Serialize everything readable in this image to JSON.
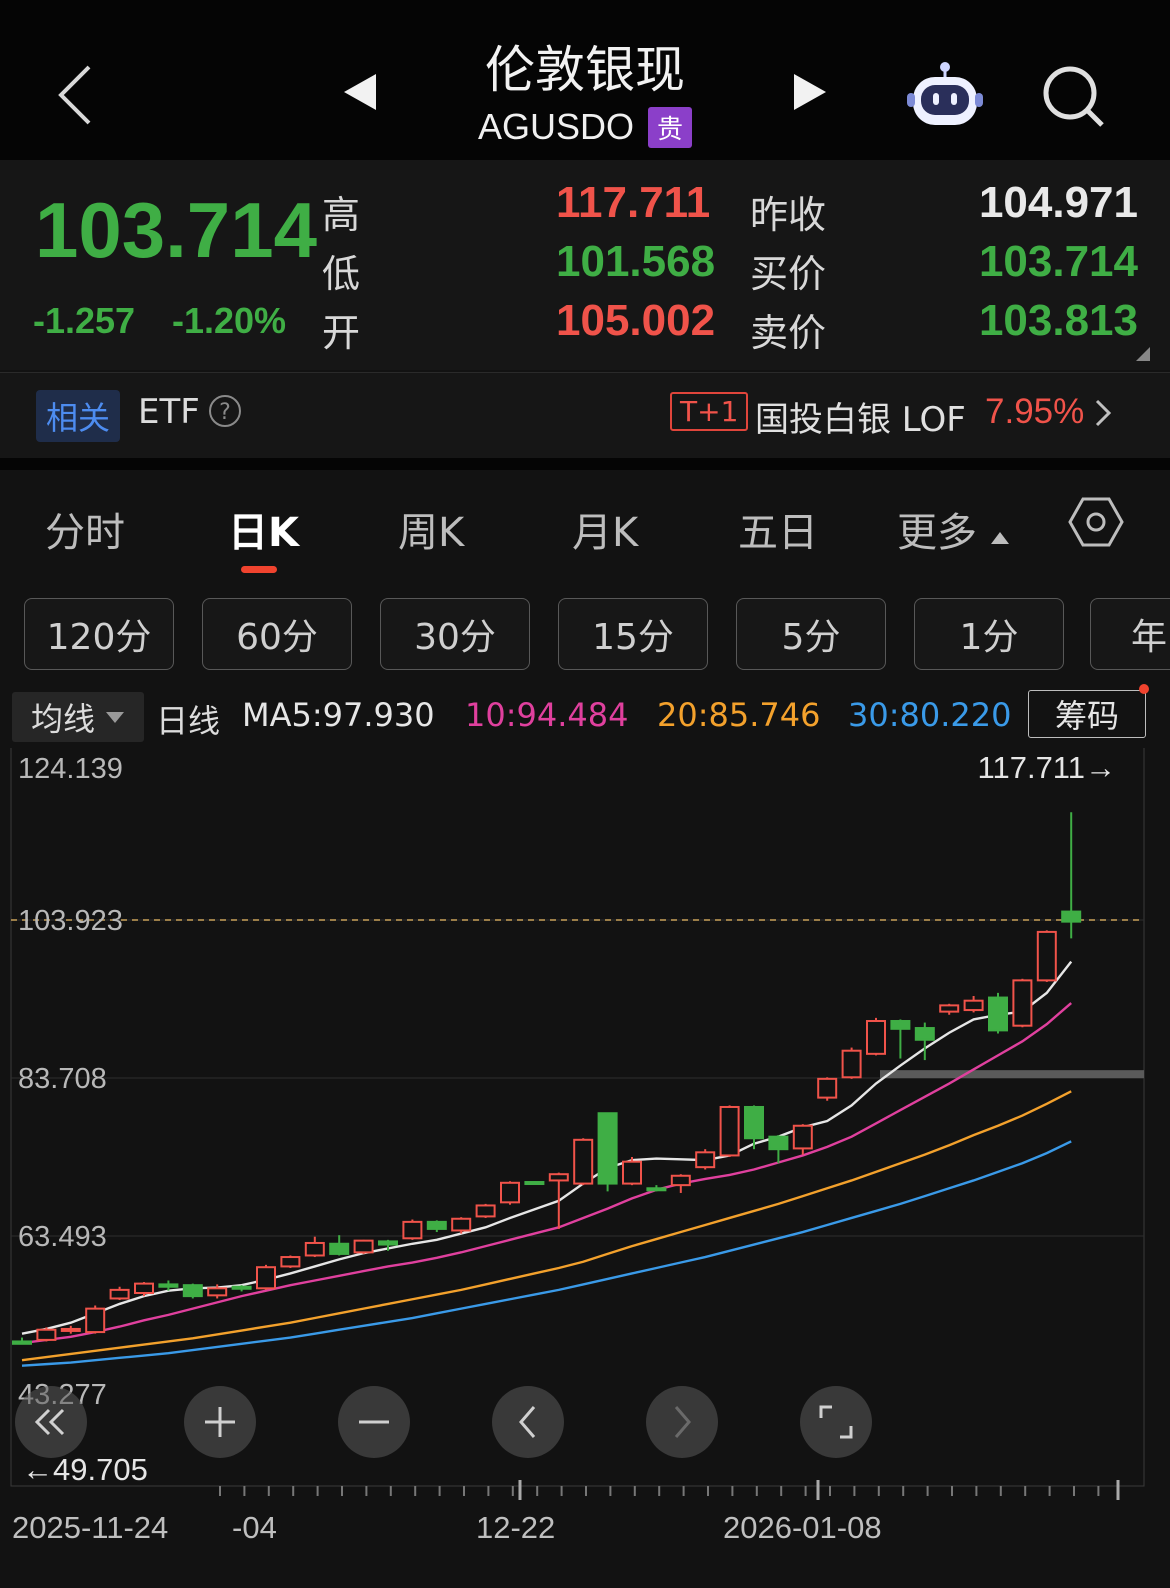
{
  "header": {
    "title": "伦敦银现",
    "symbol": "AGUSDO",
    "badge": "贵"
  },
  "quote": {
    "price": "103.714",
    "change": "-1.257",
    "change_pct": "-1.20%",
    "high_label": "高",
    "high": "117.711",
    "low_label": "低",
    "low": "101.568",
    "open_label": "开",
    "open": "105.002",
    "prev_close_label": "昨收",
    "prev_close": "104.971",
    "bid_label": "买价",
    "bid": "103.714",
    "ask_label": "卖价",
    "ask": "103.813"
  },
  "etf": {
    "tag": "相关",
    "label": "ETF",
    "badge": "T+1",
    "name": "国投白银 LOF",
    "pct": "7.95%"
  },
  "tabs": [
    {
      "label": "分时",
      "active": false
    },
    {
      "label": "日K",
      "active": true
    },
    {
      "label": "周K",
      "active": false
    },
    {
      "label": "月K",
      "active": false
    },
    {
      "label": "五日",
      "active": false
    },
    {
      "label": "更多",
      "active": false
    }
  ],
  "intervals": [
    "120分",
    "60分",
    "30分",
    "15分",
    "5分",
    "1分",
    "年"
  ],
  "ma_bar": {
    "selector": "均线",
    "period": "日线",
    "ma5": "MA5:97.930",
    "ma10": "10:94.484",
    "ma20": "20:85.746",
    "ma30": "30:80.220",
    "chip_button": "筹码"
  },
  "colors": {
    "up": "#f0534a",
    "down": "#3fae45",
    "ma5": "#e6e6e6",
    "ma10": "#e0409e",
    "ma20": "#f3a12c",
    "ma30": "#3a9ae8",
    "accent_underline": "#f0432e",
    "badge_purple": "#8b3fc9"
  },
  "chart_data": {
    "type": "candlestick",
    "y_tick_labels": [
      "124.139",
      "103.923",
      "83.708",
      "63.493",
      "43.277"
    ],
    "ylim": [
      43.277,
      124.139
    ],
    "x_tick_labels": [
      "2025-11-24",
      "-04",
      "12-22",
      "2026-01-08"
    ],
    "current_price_line": 103.923,
    "max_marker": "117.711→",
    "min_marker": "←49.705",
    "candles": [
      {
        "o": 50.0,
        "h": 50.5,
        "c": 49.7,
        "l": 49.7
      },
      {
        "o": 50.2,
        "h": 51.8,
        "c": 51.5,
        "l": 50.0
      },
      {
        "o": 51.4,
        "h": 52.0,
        "c": 51.6,
        "l": 51.0
      },
      {
        "o": 51.2,
        "h": 54.6,
        "c": 54.2,
        "l": 51.0
      },
      {
        "o": 55.5,
        "h": 57.0,
        "c": 56.6,
        "l": 55.3
      },
      {
        "o": 56.2,
        "h": 57.6,
        "c": 57.4,
        "l": 55.8
      },
      {
        "o": 57.3,
        "h": 57.8,
        "c": 57.0,
        "l": 56.5
      },
      {
        "o": 57.2,
        "h": 57.4,
        "c": 55.8,
        "l": 55.5
      },
      {
        "o": 55.9,
        "h": 57.3,
        "c": 56.8,
        "l": 55.5
      },
      {
        "o": 57.0,
        "h": 57.2,
        "c": 56.9,
        "l": 56.4
      },
      {
        "o": 56.8,
        "h": 59.8,
        "c": 59.5,
        "l": 56.6
      },
      {
        "o": 59.6,
        "h": 61.0,
        "c": 60.8,
        "l": 59.4
      },
      {
        "o": 61.0,
        "h": 63.4,
        "c": 62.6,
        "l": 60.8
      },
      {
        "o": 62.5,
        "h": 63.6,
        "c": 61.2,
        "l": 61.0
      },
      {
        "o": 61.4,
        "h": 63.0,
        "c": 62.9,
        "l": 61.2
      },
      {
        "o": 62.8,
        "h": 63.0,
        "c": 62.4,
        "l": 61.6
      },
      {
        "o": 63.2,
        "h": 65.6,
        "c": 65.3,
        "l": 63.0
      },
      {
        "o": 65.3,
        "h": 65.5,
        "c": 64.4,
        "l": 64.0
      },
      {
        "o": 64.2,
        "h": 65.9,
        "c": 65.7,
        "l": 63.8
      },
      {
        "o": 66.0,
        "h": 67.6,
        "c": 67.4,
        "l": 65.8
      },
      {
        "o": 67.8,
        "h": 70.5,
        "c": 70.3,
        "l": 67.5
      },
      {
        "o": 70.4,
        "h": 70.5,
        "c": 70.3,
        "l": 70.2
      },
      {
        "o": 70.6,
        "h": 71.6,
        "c": 71.4,
        "l": 64.4
      },
      {
        "o": 70.2,
        "h": 76.0,
        "c": 75.8,
        "l": 70.0
      },
      {
        "o": 79.2,
        "h": 79.2,
        "c": 70.2,
        "l": 69.2
      },
      {
        "o": 70.2,
        "h": 73.6,
        "c": 73.0,
        "l": 70.0
      },
      {
        "o": 69.6,
        "h": 70.0,
        "c": 69.4,
        "l": 69.2
      },
      {
        "o": 70.0,
        "h": 71.4,
        "c": 71.2,
        "l": 69.0
      },
      {
        "o": 72.3,
        "h": 74.6,
        "c": 74.2,
        "l": 72.0
      },
      {
        "o": 73.8,
        "h": 80.2,
        "c": 80.0,
        "l": 73.6
      },
      {
        "o": 80.0,
        "h": 80.2,
        "c": 76.0,
        "l": 74.6
      },
      {
        "o": 76.2,
        "h": 76.4,
        "c": 74.6,
        "l": 72.8
      },
      {
        "o": 74.7,
        "h": 77.8,
        "c": 77.6,
        "l": 73.9
      },
      {
        "o": 81.2,
        "h": 83.8,
        "c": 83.6,
        "l": 80.8
      },
      {
        "o": 83.8,
        "h": 87.6,
        "c": 87.2,
        "l": 83.6
      },
      {
        "o": 86.8,
        "h": 91.4,
        "c": 91.0,
        "l": 86.6
      },
      {
        "o": 91.0,
        "h": 91.2,
        "c": 90.0,
        "l": 86.2
      },
      {
        "o": 90.1,
        "h": 90.8,
        "c": 88.6,
        "l": 86.0
      },
      {
        "o": 92.2,
        "h": 93.2,
        "c": 93.0,
        "l": 91.8
      },
      {
        "o": 92.4,
        "h": 94.2,
        "c": 93.6,
        "l": 92.1
      },
      {
        "o": 94.0,
        "h": 94.6,
        "c": 89.8,
        "l": 89.4
      },
      {
        "o": 90.4,
        "h": 96.4,
        "c": 96.2,
        "l": 90.2
      },
      {
        "o": 96.2,
        "h": 102.6,
        "c": 102.4,
        "l": 96.0
      },
      {
        "o": 105.002,
        "h": 117.711,
        "c": 103.714,
        "l": 101.568
      }
    ],
    "ma5": [
      51.0,
      51.6,
      52.4,
      53.6,
      54.8,
      55.8,
      56.5,
      56.8,
      56.9,
      57.2,
      57.9,
      58.7,
      59.6,
      60.5,
      61.3,
      61.9,
      62.5,
      63.0,
      63.8,
      64.6,
      65.8,
      66.9,
      68.0,
      70.2,
      72.2,
      73.2,
      73.4,
      73.3,
      73.2,
      73.8,
      75.3,
      76.2,
      77.4,
      78.2,
      80.2,
      83.0,
      85.3,
      87.5,
      89.5,
      91.2,
      91.8,
      92.2,
      94.6,
      98.6
    ],
    "ma10": [
      49.8,
      50.2,
      50.6,
      51.2,
      51.9,
      52.7,
      53.4,
      54.2,
      55.0,
      55.8,
      56.5,
      57.2,
      57.8,
      58.4,
      59.0,
      59.6,
      60.1,
      60.7,
      61.4,
      62.2,
      63.0,
      63.8,
      64.6,
      65.8,
      67.0,
      68.3,
      69.4,
      70.2,
      70.8,
      71.3,
      72.0,
      72.9,
      73.8,
      74.9,
      76.2,
      77.9,
      79.6,
      81.3,
      83.0,
      84.8,
      86.6,
      88.4,
      90.6,
      93.3
    ],
    "ma20": [
      47.6,
      48.0,
      48.4,
      48.8,
      49.2,
      49.6,
      50.0,
      50.4,
      50.9,
      51.4,
      51.9,
      52.4,
      53.0,
      53.6,
      54.2,
      54.8,
      55.4,
      56.0,
      56.6,
      57.3,
      58.0,
      58.7,
      59.4,
      60.2,
      61.2,
      62.2,
      63.1,
      64.0,
      64.9,
      65.8,
      66.7,
      67.6,
      68.6,
      69.6,
      70.6,
      71.7,
      72.8,
      73.9,
      75.1,
      76.4,
      77.6,
      78.9,
      80.4,
      82.0
    ],
    "ma30": [
      46.9,
      47.1,
      47.3,
      47.6,
      47.9,
      48.2,
      48.5,
      48.9,
      49.3,
      49.7,
      50.1,
      50.5,
      51.0,
      51.5,
      52.0,
      52.5,
      53.0,
      53.6,
      54.2,
      54.8,
      55.4,
      56.0,
      56.6,
      57.3,
      58.0,
      58.7,
      59.4,
      60.1,
      60.8,
      61.6,
      62.4,
      63.2,
      64.0,
      64.9,
      65.8,
      66.7,
      67.6,
      68.6,
      69.6,
      70.6,
      71.7,
      72.8,
      74.1,
      75.6
    ]
  }
}
